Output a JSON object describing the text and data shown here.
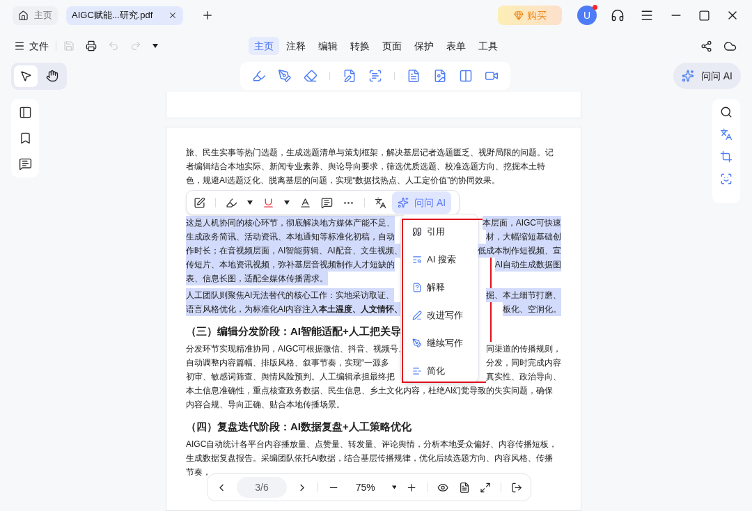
{
  "top_tabs": [
    {
      "label": "主页",
      "kind": "home",
      "selected": false
    },
    {
      "label": "AIGC赋能...研究.pdf",
      "kind": "file",
      "selected": true
    }
  ],
  "buy_button": {
    "label": "购买"
  },
  "avatar": {
    "initial": "U",
    "notification": true
  },
  "file_menu": {
    "label": "文件"
  },
  "quick_actions": [
    {
      "kind": "save",
      "disabled": true
    },
    {
      "kind": "print",
      "disabled": false
    },
    {
      "kind": "undo",
      "disabled": true
    },
    {
      "kind": "redo",
      "disabled": true
    }
  ],
  "ribbon_tabs": [
    {
      "label": "主页",
      "selected": true
    },
    {
      "label": "注释",
      "selected": false
    },
    {
      "label": "编辑",
      "selected": false
    },
    {
      "label": "转换",
      "selected": false
    },
    {
      "label": "页面",
      "selected": false
    },
    {
      "label": "保护",
      "selected": false
    },
    {
      "label": "表单",
      "selected": false
    },
    {
      "label": "工具",
      "selected": false
    }
  ],
  "tool_modes": [
    {
      "kind": "pointer",
      "selected": true
    },
    {
      "kind": "hand",
      "selected": false
    }
  ],
  "ask_ai_button": {
    "label": "问问 AI"
  },
  "document": {
    "blocks": [
      {
        "kind": "paragraph",
        "selected": false,
        "lines": [
          {
            "left": "旅、民生实事等热门选题，生成选题清单与策划框架，解决基层记者选题匮乏、视野局限的问题。记"
          },
          {
            "left": "者编辑结合本地实际、新闻专业素养、舆论导向要求，筛选优质选题、校准选题方向、挖掘本土特"
          },
          {
            "left": "色，规避AI选题泛化、脱离基层的问题，实现“数据找热点、人工定价值”的协同效果。"
          }
        ]
      },
      {
        "kind": "toolbar"
      },
      {
        "kind": "paragraph",
        "selected": true,
        "lines": [
          {
            "left": "这是人机协同的核心环节，彻底解决地方媒体产能不足、",
            "right": "本层面，AIGC可快速"
          },
          {
            "left": "生成政务简讯、活动资讯、本地通知等标准化初稿，自动",
            "right": "材，大幅缩短基础创"
          },
          {
            "left": "作时长；在音视频层面，AI智能剪辑、AI配音、文生视频、",
            "right": "低成本制作短视频、宣"
          },
          {
            "left": "传短片、本地资讯视频，弥补基层音视频制作人才短缺的",
            "right": "AI自动生成数据图"
          },
          {
            "left": "表、信息长图，适配全媒体传播需求。"
          }
        ]
      },
      {
        "kind": "paragraph",
        "selected": true,
        "lines": [
          {
            "left": "人工团队则聚焦AI无法替代的核心工作：实地采访取证、",
            "right": "掘、本土细节打磨、"
          },
          {
            "left": "语言风格优化，为标准化AI内容注入**本土温度、人文情怀、**",
            "right": "板化、空洞化。"
          }
        ]
      },
      {
        "kind": "heading",
        "text": "（三）编辑分发阶段：AI智能适配+人工把关导"
      },
      {
        "kind": "paragraph",
        "selected": false,
        "lines": [
          {
            "left": "分发环节实现精准协同，AIGC可根据微信、抖音、视频号、",
            "right": "同渠道的传播规则，"
          },
          {
            "left": "自动调整内容篇幅、排版风格、叙事节奏，实现“一源多",
            "right": "分发，同时完成内容"
          },
          {
            "left": "初审、敏感词筛查、舆情风险预判。人工编辑承担最终把",
            "right": "真实性、政治导向、"
          },
          {
            "left": "本土信息准确性，重点核查政务数据、民生信息、乡土文化内容，杜绝AI幻觉导致的失实问题，确保"
          },
          {
            "left": "内容合规、导向正确、贴合本地传播场景。"
          }
        ]
      },
      {
        "kind": "heading",
        "text": "（四）复盘迭代阶段：AI数据复盘+人工策略优化"
      },
      {
        "kind": "paragraph",
        "selected": false,
        "lines": [
          {
            "left": "AIGC自动统计各平台内容播放量、点赞量、转发量、评论舆情，分析本地受众偏好、内容传播短板，"
          },
          {
            "left": "生成数据复盘报告。采编团队依托AI数据，结合基层传播规律，优化后续选题方向、内容风格、传播"
          },
          {
            "left": "节奏，"
          }
        ]
      }
    ]
  },
  "selection_toolbar": {
    "ask_ai": "问问 AI"
  },
  "ai_menu": [
    {
      "kind": "quote",
      "label": "引用"
    },
    {
      "kind": "search",
      "label": "AI 搜索"
    },
    {
      "kind": "explain",
      "label": "解释"
    },
    {
      "kind": "improve",
      "label": "改进写作"
    },
    {
      "kind": "continue",
      "label": "继续写作"
    },
    {
      "kind": "simplify",
      "label": "简化"
    }
  ],
  "page_nav": {
    "page": "3/6",
    "zoom": "75%"
  }
}
